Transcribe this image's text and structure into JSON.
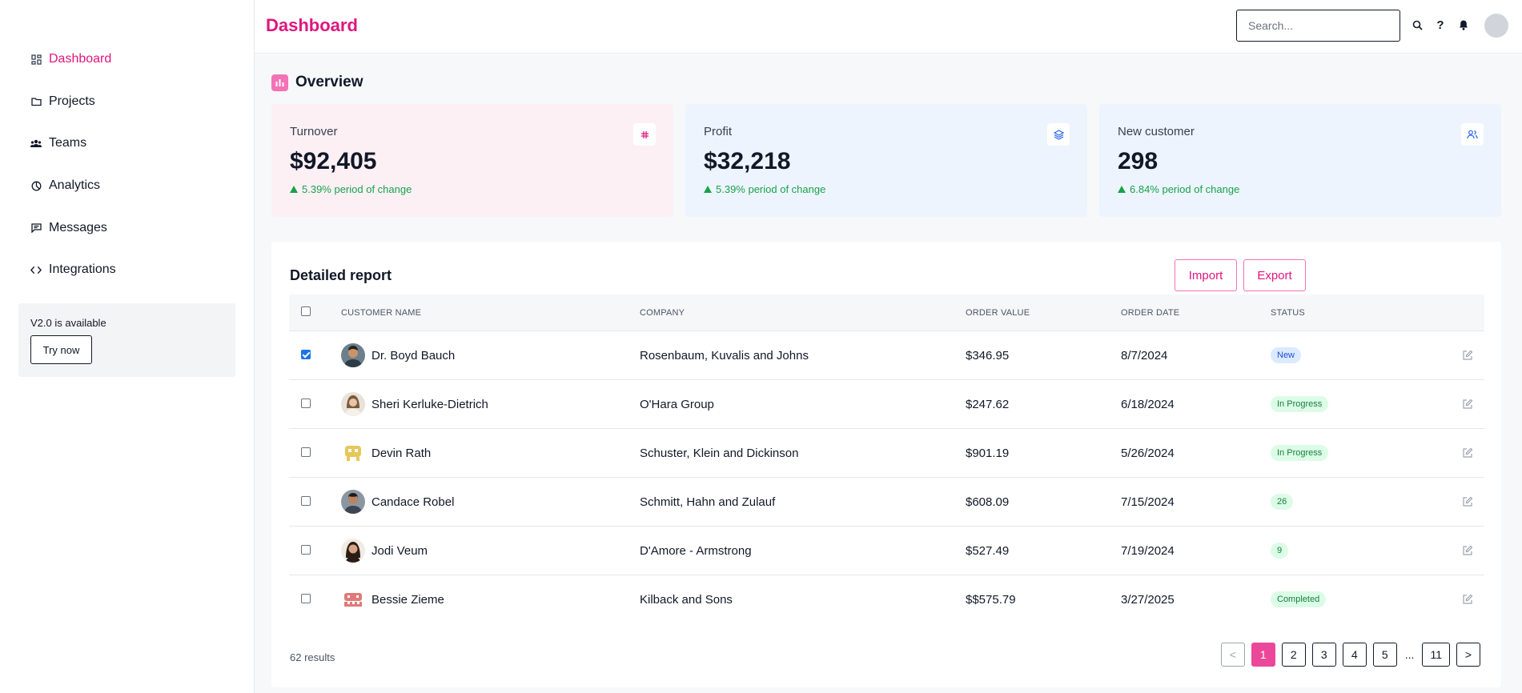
{
  "sidebar": {
    "items": [
      {
        "label": "Dashboard",
        "icon": "grid-icon"
      },
      {
        "label": "Projects",
        "icon": "folder-icon"
      },
      {
        "label": "Teams",
        "icon": "users-icon"
      },
      {
        "label": "Analytics",
        "icon": "pie-icon"
      },
      {
        "label": "Messages",
        "icon": "message-icon"
      },
      {
        "label": "Integrations",
        "icon": "code-icon"
      }
    ],
    "promo": {
      "text": "V2.0 is available",
      "button": "Try now"
    }
  },
  "header": {
    "title": "Dashboard",
    "search_placeholder": "Search...",
    "help_label": "?"
  },
  "overview": {
    "title": "Overview",
    "cards": [
      {
        "label": "Turnover",
        "value": "$92,405",
        "change": "5.39% period of change"
      },
      {
        "label": "Profit",
        "value": "$32,218",
        "change": "5.39% period of change"
      },
      {
        "label": "New customer",
        "value": "298",
        "change": "6.84% period of change"
      }
    ]
  },
  "report": {
    "title": "Detailed report",
    "import_label": "Import",
    "export_label": "Export",
    "columns": {
      "name": "CUSTOMER NAME",
      "company": "COMPANY",
      "value": "ORDER VALUE",
      "date": "ORDER DATE",
      "status": "STATUS"
    },
    "rows": [
      {
        "name": "Dr. Boyd Bauch",
        "company": "Rosenbaum, Kuvalis and Johns",
        "value": "$346.95",
        "date": "8/7/2024",
        "status": "New",
        "checked": true
      },
      {
        "name": "Sheri Kerluke-Dietrich",
        "company": "O'Hara Group",
        "value": "$247.62",
        "date": "6/18/2024",
        "status": "In Progress",
        "checked": false
      },
      {
        "name": "Devin Rath",
        "company": "Schuster, Klein and Dickinson",
        "value": "$901.19",
        "date": "5/26/2024",
        "status": "In Progress",
        "checked": false
      },
      {
        "name": "Candace Robel",
        "company": "Schmitt, Hahn and Zulauf",
        "value": "$608.09",
        "date": "7/15/2024",
        "status": "26",
        "checked": false
      },
      {
        "name": "Jodi Veum",
        "company": "D'Amore - Armstrong",
        "value": "$527.49",
        "date": "7/19/2024",
        "status": "9",
        "checked": false
      },
      {
        "name": "Bessie Zieme",
        "company": "Kilback and Sons",
        "value": "$$575.79",
        "date": "3/27/2025",
        "status": "Completed",
        "checked": false
      }
    ],
    "results": "62 results",
    "pagination": {
      "prev": "<",
      "pages": [
        "1",
        "2",
        "3",
        "4",
        "5"
      ],
      "ellipsis": "...",
      "last": "11",
      "next": ">",
      "current": "1"
    }
  },
  "colors": {
    "accent": "#e0157e",
    "accent_light": "#ec4899",
    "success": "#16a34a",
    "card_pink": "#fdf0f5",
    "card_blue": "#eef4fe"
  }
}
